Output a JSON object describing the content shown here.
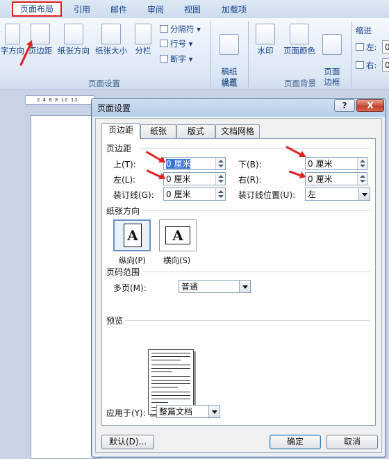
{
  "ribbon": {
    "tabs": [
      "页面布局",
      "引用",
      "邮件",
      "审阅",
      "视图",
      "加载项"
    ],
    "buttons": {
      "text_direction": "字方向",
      "margins": "页边距",
      "orientation": "纸张方向",
      "size": "纸张大小",
      "columns": "分栏",
      "breaks": "分隔符",
      "line_numbers": "行号",
      "hyphenation": "断字",
      "draft_settings": "稿纸\n设置",
      "watermark": "水印",
      "page_color": "页面颜色",
      "page_borders": "页面\n边框"
    },
    "groups": {
      "page_setup": "页面设置",
      "draft": "稿纸",
      "page_background": "页面背景",
      "indent": "缩进"
    },
    "indent": {
      "left": "左:",
      "right": "右:",
      "left_value": "0",
      "right_value": "0"
    }
  },
  "ruler": {
    "ticks": "2 4 6 8 10 12"
  },
  "dialog": {
    "title": "页面设置",
    "help": "?",
    "close": "X",
    "tabs": [
      "页边距",
      "纸张",
      "版式",
      "文档网格"
    ],
    "margins_section": "页边距",
    "fields": {
      "top": {
        "label": "上(T):",
        "value": "0 厘米"
      },
      "bottom": {
        "label": "下(B):",
        "value": "0 厘米"
      },
      "left": {
        "label": "左(L):",
        "value": "0 厘米"
      },
      "right": {
        "label": "右(R):",
        "value": "0 厘米"
      },
      "gutter": {
        "label": "装订线(G):",
        "value": "0 厘米"
      },
      "gutter_pos": {
        "label": "装订线位置(U):",
        "value": "左"
      }
    },
    "orientation_section": "纸张方向",
    "portrait": "纵向(P)",
    "landscape": "横向(S)",
    "page_glyph": "A",
    "pages_section": "页码范围",
    "multiple_pages": {
      "label": "多页(M):",
      "value": "普通"
    },
    "preview_section": "预览",
    "apply_to": {
      "label": "应用于(Y):",
      "value": "整篇文档"
    },
    "default_button": "默认(D)...",
    "ok_button": "确定",
    "cancel_button": "取消"
  },
  "colors": {
    "highlight": "#e02020",
    "selection": "#3875d7",
    "ribbon_text": "#15428b"
  }
}
